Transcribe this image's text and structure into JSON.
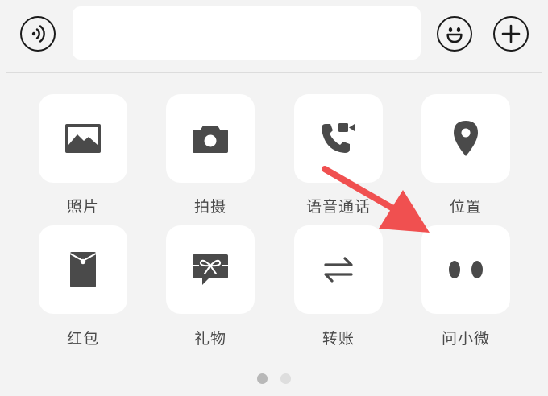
{
  "toolbar": {
    "voice_icon": "voice-input-icon",
    "message_input": {
      "value": "",
      "placeholder": ""
    },
    "emoji_icon": "emoji-icon",
    "more_icon": "plus-icon"
  },
  "panel": {
    "items": [
      {
        "label": "照片",
        "icon": "photo-icon"
      },
      {
        "label": "拍摄",
        "icon": "camera-icon"
      },
      {
        "label": "语音通话",
        "icon": "voice-call-icon"
      },
      {
        "label": "位置",
        "icon": "location-pin-icon"
      },
      {
        "label": "红包",
        "icon": "red-envelope-icon"
      },
      {
        "label": "礼物",
        "icon": "gift-icon"
      },
      {
        "label": "转账",
        "icon": "transfer-icon"
      },
      {
        "label": "问小微",
        "icon": "xiaowei-eyes-icon"
      }
    ]
  },
  "pagination": {
    "pages": 2,
    "current": 1
  },
  "colors": {
    "background": "#f3f3f3",
    "tile": "#ffffff",
    "icon": "#4a4a4a",
    "annotation_arrow": "#f05050",
    "page_dot_active": "#b8b8b8",
    "page_dot_inactive": "#dedede"
  }
}
